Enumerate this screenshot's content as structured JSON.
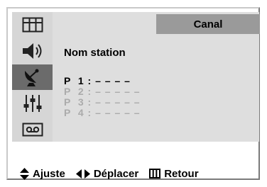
{
  "header": {
    "title": "Canal"
  },
  "sidebar": {
    "items": [
      {
        "icon": "picture-icon",
        "active": false
      },
      {
        "icon": "sound-icon",
        "active": false
      },
      {
        "icon": "satellite-dish-icon",
        "active": true
      },
      {
        "icon": "equalizer-icon",
        "active": false
      },
      {
        "icon": "tape-icon",
        "active": false
      }
    ]
  },
  "main": {
    "heading": "Nom station",
    "stations": [
      {
        "label": "P  1 : – – – –"
      },
      {
        "label": "P  2 : – – – – –"
      },
      {
        "label": "P  3 : – – – – –"
      },
      {
        "label": "P  4 : – – – – –"
      }
    ],
    "selected_index": 0
  },
  "footer": {
    "adjust_label": "Ajuste",
    "move_label": "Déplacer",
    "return_label": "Retour"
  },
  "colors": {
    "panel": "#dedede",
    "active_item": "#6b6b6b",
    "title_bar": "#9a9a9a",
    "inactive_text": "#ababab"
  }
}
